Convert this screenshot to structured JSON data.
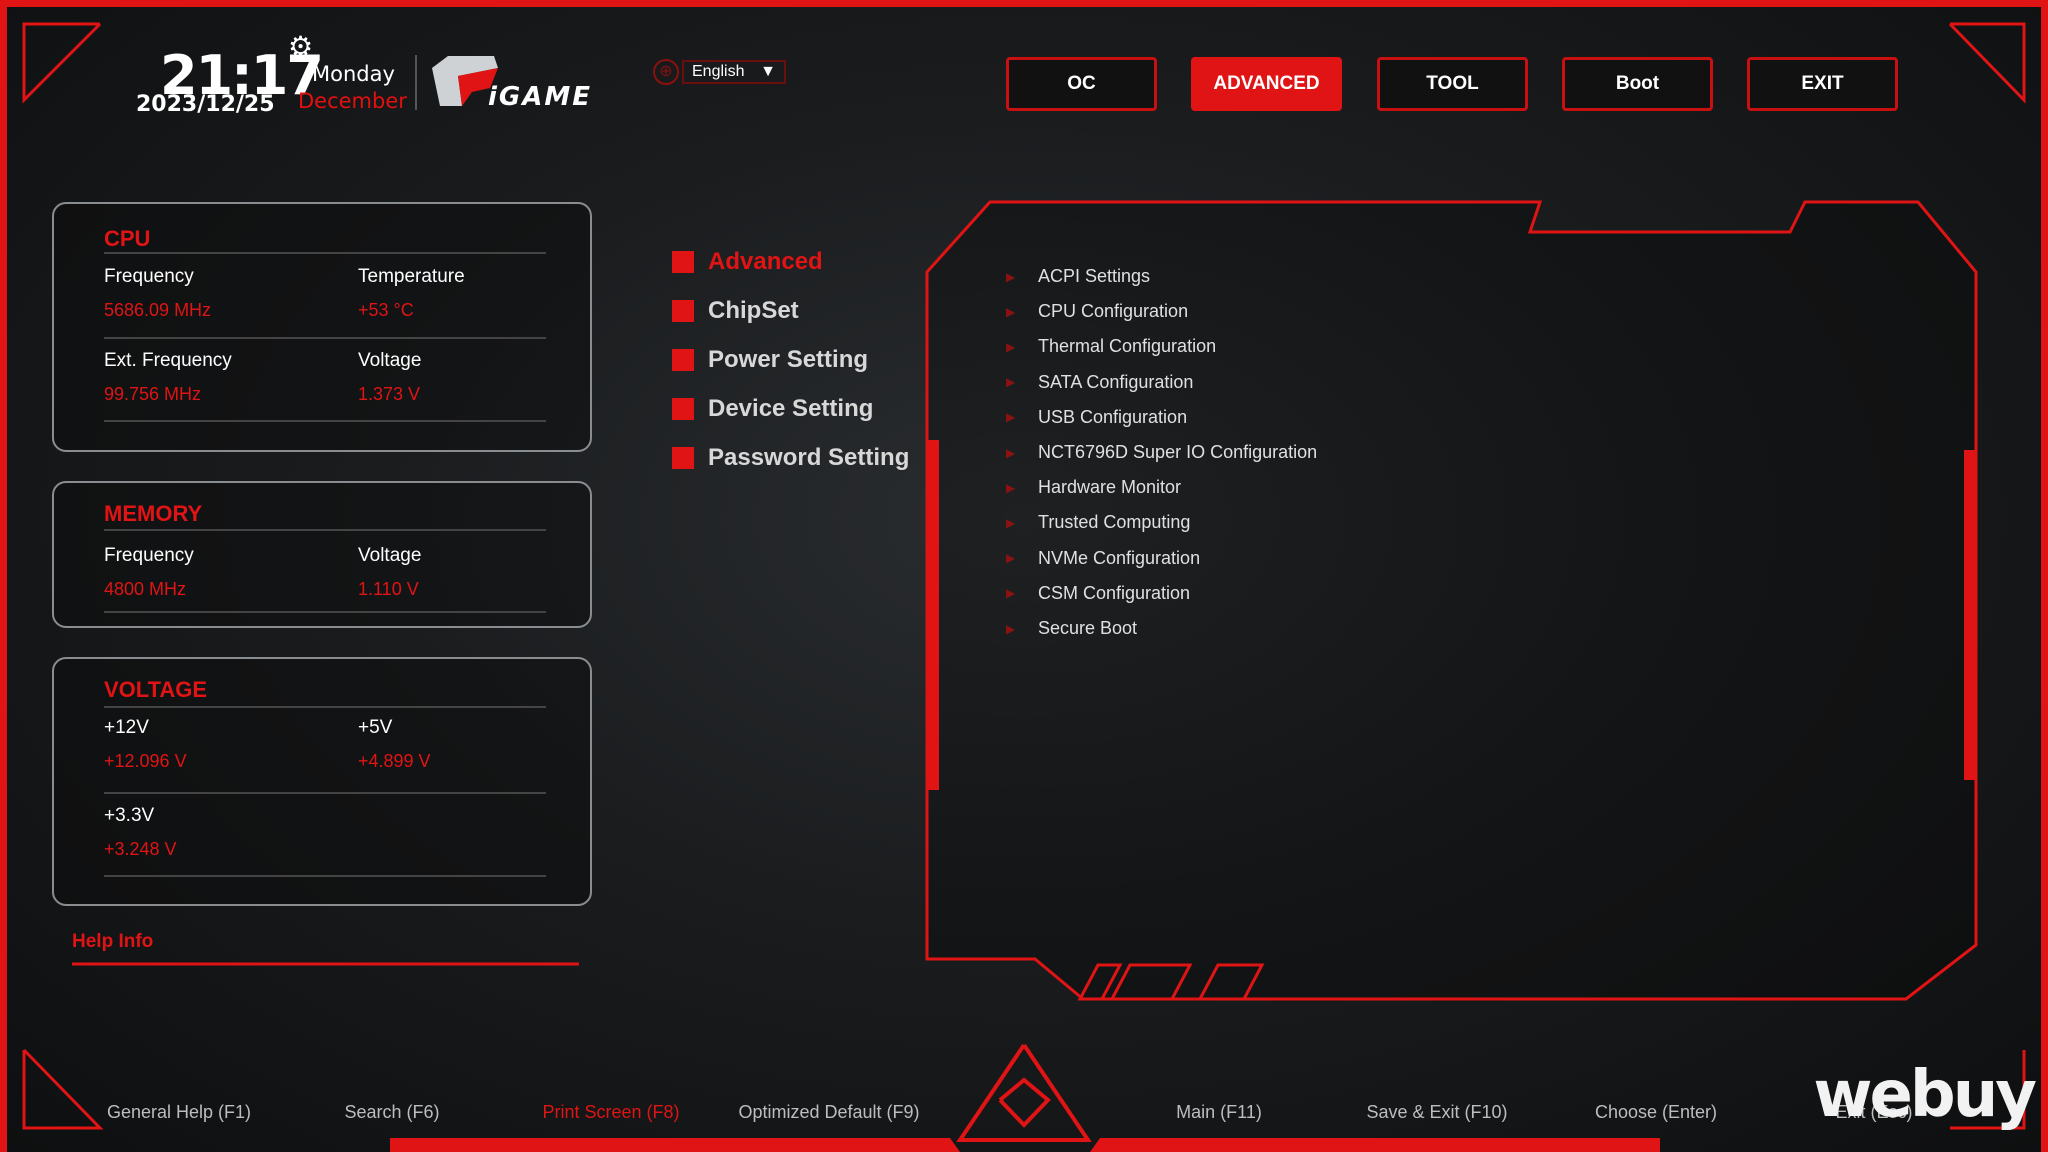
{
  "header": {
    "time": "21:17",
    "date": "2023/12/25",
    "weekday": "Monday",
    "month": "December",
    "brand": "iGAME",
    "language": "English"
  },
  "tabs": [
    {
      "label": "OC",
      "active": false
    },
    {
      "label": "ADVANCED",
      "active": true
    },
    {
      "label": "TOOL",
      "active": false
    },
    {
      "label": "Boot",
      "active": false
    },
    {
      "label": "EXIT",
      "active": false
    }
  ],
  "cpu": {
    "title": "CPU",
    "frequency_label": "Frequency",
    "frequency": "5686.09 MHz",
    "temperature_label": "Temperature",
    "temperature": "+53 °C",
    "ext_frequency_label": "Ext. Frequency",
    "ext_frequency": "99.756 MHz",
    "voltage_label": "Voltage",
    "voltage": "1.373 V"
  },
  "memory": {
    "title": "MEMORY",
    "frequency_label": "Frequency",
    "frequency": "4800 MHz",
    "voltage_label": "Voltage",
    "voltage": "1.110 V"
  },
  "voltage": {
    "title": "VOLTAGE",
    "v12_label": "+12V",
    "v12": "+12.096 V",
    "v5_label": "+5V",
    "v5": "+4.899 V",
    "v33_label": "+3.3V",
    "v33": "+3.248 V"
  },
  "help_info": "Help Info",
  "menu": [
    {
      "label": "Advanced",
      "active": true
    },
    {
      "label": "ChipSet"
    },
    {
      "label": "Power Setting"
    },
    {
      "label": "Device Setting"
    },
    {
      "label": "Password Setting"
    }
  ],
  "submenu": [
    "ACPI Settings",
    "CPU Configuration",
    "Thermal Configuration",
    "SATA Configuration",
    "USB Configuration",
    "NCT6796D Super IO Configuration",
    "Hardware Monitor",
    "Trusted Computing",
    "NVMe Configuration",
    "CSM Configuration",
    "Secure Boot"
  ],
  "footer": [
    "General Help (F1)",
    "Search (F6)",
    "Print Screen (F8)",
    "Optimized Default (F9)",
    "Main (F11)",
    "Save & Exit (F10)",
    "Choose (Enter)",
    "Exit (Esc)"
  ],
  "watermark": "webuy",
  "colors": {
    "accent": "#e01414",
    "background": "#151719"
  }
}
